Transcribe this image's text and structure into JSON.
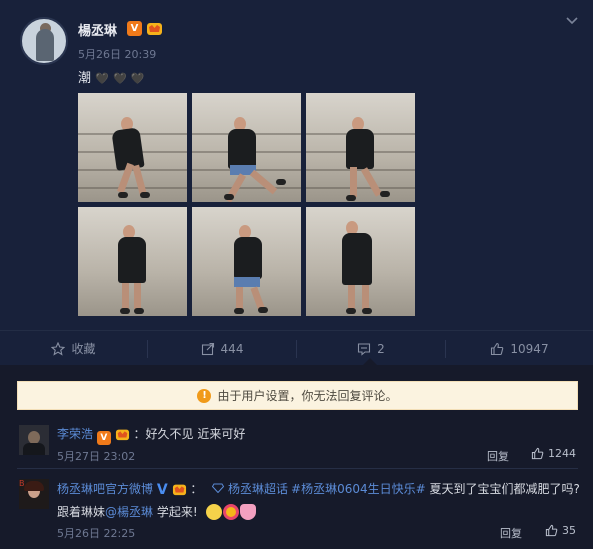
{
  "post": {
    "username": "楊丞琳",
    "timestamp": "5月26日 20:39",
    "text": "潮",
    "hearts": [
      "🖤",
      "🖤",
      "🖤"
    ],
    "verified_label": "V",
    "photo_count": 6
  },
  "actions": {
    "favorite_label": "收藏",
    "repost_count": "444",
    "comment_count": "2",
    "like_count": "10947"
  },
  "notice": {
    "icon": "!",
    "text": "由于用户设置，你无法回复评论。"
  },
  "comments": [
    {
      "name": "李荣浩",
      "verified": "V",
      "separator": "：",
      "text": "好久不见 近来可好",
      "time": "5月27日 23:02",
      "reply_label": "回复",
      "likes": "1244"
    },
    {
      "name": "杨丞琳吧官方微博",
      "verified": "V",
      "separator": "：",
      "topic": "杨丞琳超话",
      "hashtag": "#杨丞琳0604生日快乐#",
      "text_line1": "夏天到了宝宝们都减肥了吗?",
      "text_line2_prefix": "跟着琳妹",
      "mention": "@楊丞琳",
      "text_line2_suffix": "学起来!",
      "time": "5月26日 22:25",
      "reply_label": "回复",
      "likes": "35"
    }
  ],
  "colors": {
    "background": "#161a2a",
    "card": "#18213a",
    "link": "#5b8bd6",
    "verified_orange": "#f07a1a",
    "notice_bg": "#fbf3e0"
  }
}
